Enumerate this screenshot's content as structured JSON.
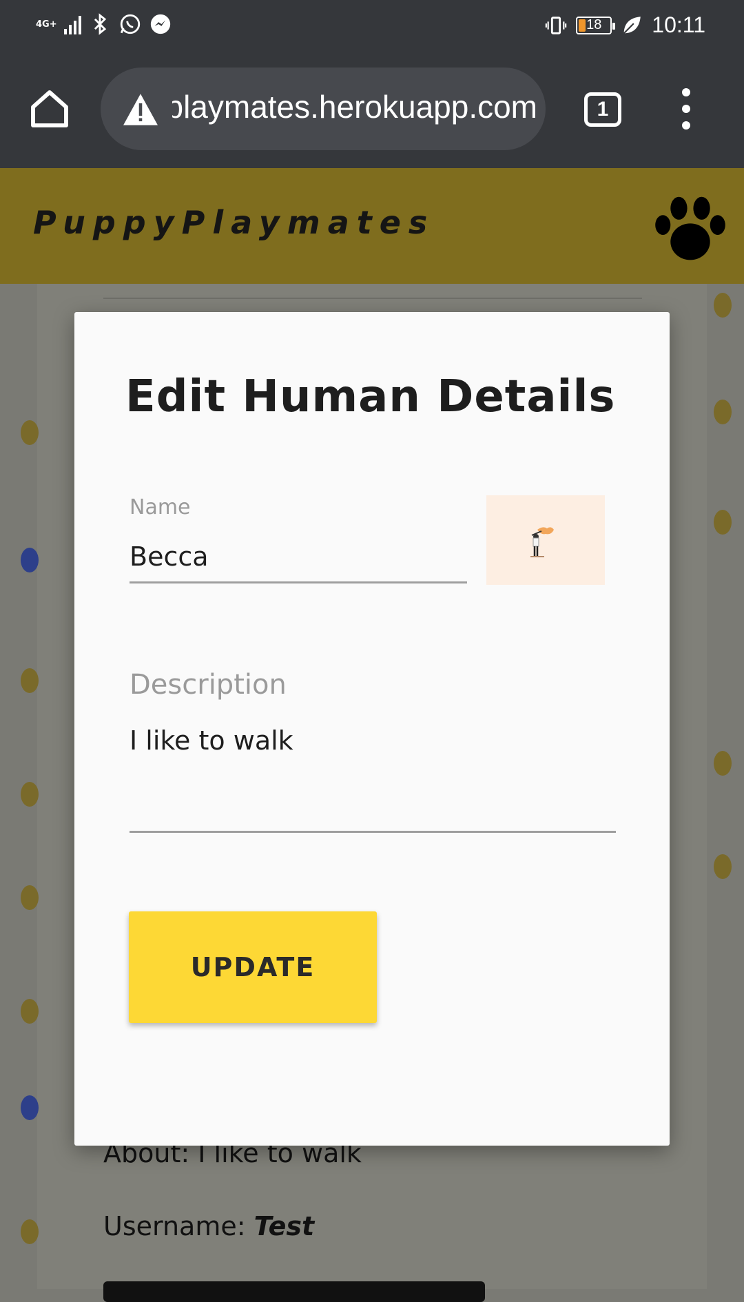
{
  "status_bar": {
    "network": "4G+",
    "battery_level": "18",
    "time": "10:11",
    "icons": [
      "signal-icon",
      "bluetooth-icon",
      "whatsapp-icon",
      "messenger-icon",
      "vibrate-icon",
      "battery-icon",
      "leaf-icon"
    ]
  },
  "browser": {
    "url": "puppyplaymates.herokuapp.com",
    "tab_count": "1",
    "icons": [
      "home-icon",
      "warning-icon",
      "tabs-icon",
      "menu-dots-icon"
    ]
  },
  "app": {
    "brand": "PuppyPlaymates",
    "logo_icon": "paw-icon",
    "brand_color": "#7f6d1e"
  },
  "modal": {
    "title": "Edit Human Details",
    "name_label": "Name",
    "name_value": "Becca",
    "description_label": "Description",
    "description_value": "I like to walk",
    "update_label": "UPDATE",
    "update_color": "#fdd835"
  },
  "background_page": {
    "about_label": "About:",
    "about_value": "I like to walk",
    "username_label": "Username:",
    "username_value": "Test"
  }
}
